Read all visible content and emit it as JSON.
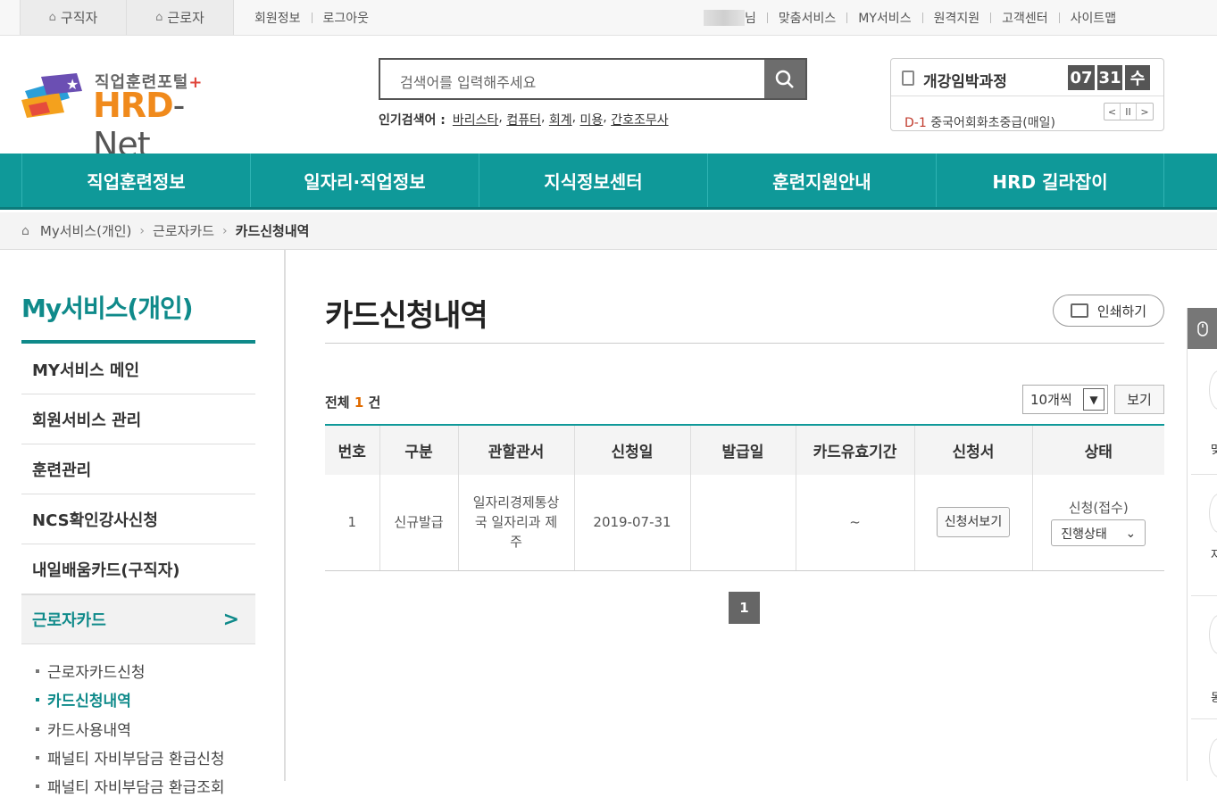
{
  "topbar": {
    "tabs": [
      {
        "label": "구직자",
        "icon": "home-icon"
      },
      {
        "label": "근로자",
        "icon": "home-icon"
      }
    ],
    "left_links": [
      "회원정보",
      "로그아웃"
    ],
    "user_suffix": "님",
    "right_links": [
      "맞춤서비스",
      "MY서비스",
      "원격지원",
      "고객센터",
      "사이트맵"
    ]
  },
  "logo": {
    "tagline": "직업훈련포털",
    "tagline_plus": "+",
    "name_orange": "HRD",
    "name_gray": "-Net"
  },
  "search": {
    "placeholder": "검색어를 입력해주세요",
    "icon": "search-icon"
  },
  "popular": {
    "label": "인기검색어 :",
    "keywords": [
      "바리스타",
      "컴퓨터",
      "회계",
      "미용",
      "간호조무사"
    ]
  },
  "closing_courses": {
    "title": "개강임박과정",
    "month": "07",
    "day": "31",
    "weekday": "수",
    "dday": "D-1",
    "course": "중국어회화초중급(매일)",
    "controls": [
      "<",
      "II",
      ">"
    ]
  },
  "gnb": [
    "직업훈련정보",
    "일자리·직업정보",
    "지식정보센터",
    "훈련지원안내",
    "HRD 길라잡이"
  ],
  "breadcrumb": [
    "My서비스(개인)",
    "근로자카드",
    "카드신청내역"
  ],
  "sidebar": {
    "heading": "My서비스(개인)",
    "items": [
      "MY서비스 메인",
      "회원서비스 관리",
      "훈련관리",
      "NCS확인강사신청",
      "내일배움카드(구직자)",
      "근로자카드"
    ],
    "active_chevron": ">",
    "subitems": [
      "근로자카드신청",
      "카드신청내역",
      "카드사용내역",
      "패널티 자비부담금 환급신청",
      "패널티 자비부담금 환급조회"
    ]
  },
  "main": {
    "title": "카드신청내역",
    "print_label": "인쇄하기",
    "total_prefix": "전체",
    "total_count": "1",
    "total_suffix": "건",
    "per_page": "10개씩",
    "view_label": "보기",
    "columns": [
      "번호",
      "구분",
      "관할관서",
      "신청일",
      "발급일",
      "카드유효기간",
      "신청서",
      "상태"
    ],
    "rows": [
      {
        "no": "1",
        "type": "신규발급",
        "office": "일자리경제통상국 일자리과 제주",
        "apply_date": "2019-07-31",
        "issue_date": "",
        "validity": "~",
        "form_button": "신청서보기",
        "status": "신청(접수)",
        "status_select": "진행상태"
      }
    ],
    "page": "1"
  },
  "quick_menu": {
    "labels": [
      "맞",
      "자",
      "동"
    ]
  },
  "colors": {
    "teal": "#0f9999",
    "orange": "#f08a1c",
    "highlight": "#e06b00"
  }
}
